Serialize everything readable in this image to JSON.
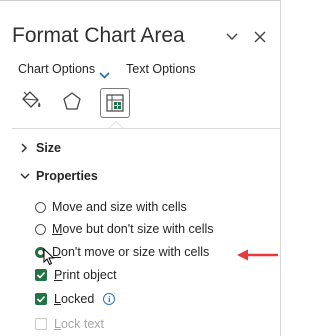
{
  "pane": {
    "title": "Format Chart Area",
    "collapse_icon": "chevron-down-icon",
    "close_icon": "close-icon"
  },
  "options_bar": {
    "chart_options_label": "Chart Options",
    "text_options_label": "Text Options",
    "dropdown_icon": "chevron-down-icon"
  },
  "tabs": [
    {
      "name": "fill-line",
      "icon": "paint-bucket-icon",
      "selected": false
    },
    {
      "name": "effects",
      "icon": "pentagon-icon",
      "selected": false
    },
    {
      "name": "size-properties",
      "icon": "size-properties-icon",
      "selected": true
    }
  ],
  "sections": {
    "size": {
      "label": "Size",
      "expanded": false
    },
    "properties": {
      "label": "Properties",
      "expanded": true,
      "radio_options": [
        {
          "label": "Move and size with cells",
          "selected": false
        },
        {
          "label": "Move but don't size with cells",
          "selected": false
        },
        {
          "label": "Don't move or size with cells",
          "selected": true
        }
      ],
      "checkboxes": [
        {
          "label": "Print object",
          "checked": true,
          "enabled": true
        },
        {
          "label": "Locked",
          "checked": true,
          "enabled": true,
          "info_icon": "info-icon"
        },
        {
          "label": "Lock text",
          "checked": false,
          "enabled": false
        }
      ]
    }
  },
  "annotation": {
    "type": "red-arrow",
    "color": "#e8383d",
    "points_to": "Don't move or size with cells"
  },
  "colors": {
    "accent_green": "#217346",
    "info_blue": "#2a74c9",
    "arrow_red": "#e8383d"
  }
}
